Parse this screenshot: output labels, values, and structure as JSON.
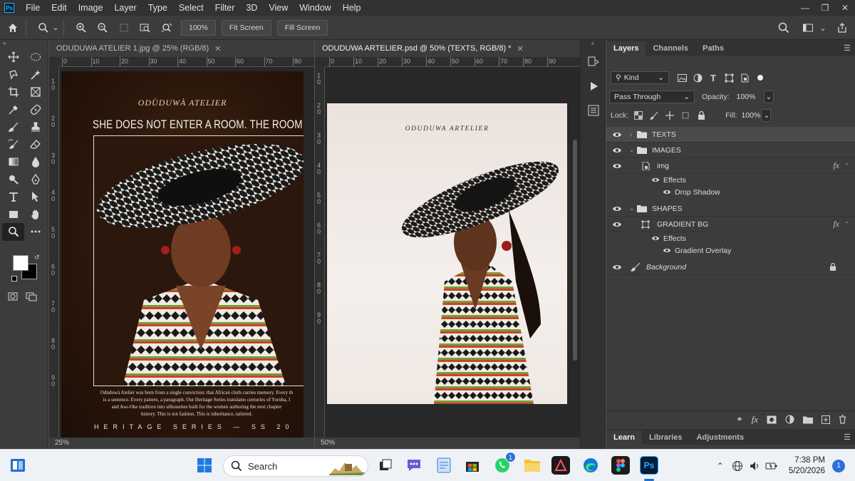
{
  "app": {
    "logo_text": "Ps"
  },
  "menu": [
    "File",
    "Edit",
    "Image",
    "Layer",
    "Type",
    "Select",
    "Filter",
    "3D",
    "View",
    "Window",
    "Help"
  ],
  "options_bar": {
    "zoom_value": "100%",
    "fit_screen_label": "Fit Screen",
    "fill_screen_label": "Fill Screen"
  },
  "documents": [
    {
      "tab_title": "ODUDUWA ATELIER 1.jpg @ 25% (RGB/8)",
      "active": false,
      "zoom": "25%",
      "ruler_h": [
        "0",
        "10",
        "20",
        "30",
        "40",
        "50",
        "60",
        "70",
        "80"
      ],
      "ruler_v": [
        "1 0",
        "2 0",
        "3 0",
        "4 0",
        "5 0",
        "6 0",
        "7 0",
        "8 0",
        "9 0"
      ],
      "brand": "ODÙDUWÀ ATELIER",
      "headline": "SHE DOES NOT ENTER A ROOM. THE ROOM BECOMES HE",
      "body": "Odùduwà Atelier was born from a single conviction: that African cloth carries memory. Every th\nis a sentence. Every pattern, a paragraph. Our Heritage Series translates centuries of Yoruba, I\nand Aso-Oke tradition into silhouettes built for the women authoring the next chapter\nhistory. This is not fashion. This is inheritance, tailored.",
      "series_line": "HERITAGE SERIES — SS 20"
    },
    {
      "tab_title": "ODUDUWA ARTELIER.psd @ 50% (TEXTS, RGB/8) *",
      "active": true,
      "zoom": "50%",
      "ruler_h": [
        "0",
        "10",
        "20",
        "30",
        "40",
        "50",
        "60",
        "70",
        "80",
        "90"
      ],
      "ruler_v": [
        "1 0",
        "2 0",
        "3 0",
        "4 0",
        "5 0",
        "6 0",
        "7 0",
        "8 0",
        "9 0"
      ],
      "brand": "ODUDUWA ARTELIER"
    }
  ],
  "panels": {
    "tabs": [
      "Layers",
      "Channels",
      "Paths"
    ],
    "filter_kind": "Kind",
    "blend_mode": "Pass Through",
    "opacity_label": "Opacity:",
    "opacity_value": "100%",
    "lock_label": "Lock:",
    "fill_label": "Fill:",
    "fill_value": "100%",
    "layers": [
      {
        "name": "TEXTS",
        "type": "group",
        "expanded": false,
        "selected": true
      },
      {
        "name": "IMAGES",
        "type": "group",
        "expanded": true
      },
      {
        "name": "img",
        "type": "smart-object",
        "fx": "fx"
      },
      {
        "name": "Effects",
        "type": "effects"
      },
      {
        "name": "Drop Shadow",
        "type": "effect"
      },
      {
        "name": "SHAPES",
        "type": "group",
        "expanded": true
      },
      {
        "name": "GRADIENT BG",
        "type": "shape",
        "fx": "fx"
      },
      {
        "name": "Effects",
        "type": "effects"
      },
      {
        "name": "Gradient Overlay",
        "type": "effect"
      },
      {
        "name": "Background",
        "type": "background",
        "locked": true
      }
    ],
    "bottom_tabs": [
      "Learn",
      "Libraries",
      "Adjustments"
    ]
  },
  "taskbar": {
    "search_placeholder": "Search",
    "whatsapp_badge": "1",
    "time": "7:38 PM",
    "date": "5/20/2026",
    "notification_count": "1"
  },
  "colors": {
    "ps_blue": "#31a8ff",
    "panel_bg": "#3c3c3c",
    "canvas_bg": "#282828",
    "taskbar_bg": "#eef1f6"
  }
}
